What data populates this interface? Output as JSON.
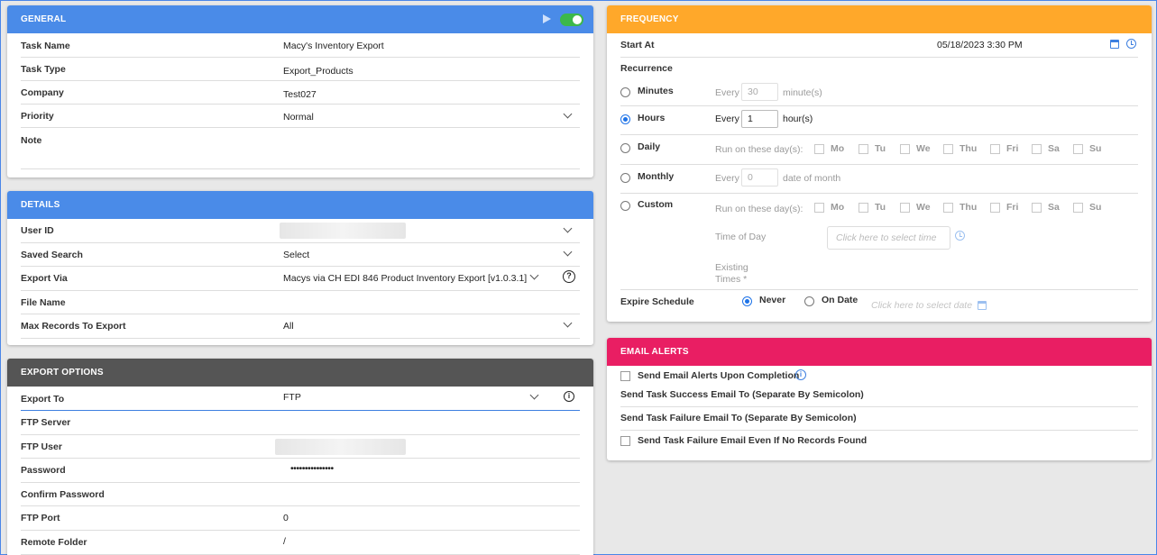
{
  "general": {
    "title": "GENERAL",
    "task_name_label": "Task Name",
    "task_name_value": "Macy's Inventory Export",
    "task_type_label": "Task Type",
    "task_type_value": "Export_Products",
    "company_label": "Company",
    "company_value": "Test027",
    "priority_label": "Priority",
    "priority_value": "Normal",
    "note_label": "Note"
  },
  "details": {
    "title": "DETAILS",
    "user_id_label": "User ID",
    "saved_search_label": "Saved Search",
    "saved_search_value": "Select",
    "export_via_label": "Export Via",
    "export_via_value": "Macys via CH EDI 846 Product Inventory Export [v1.0.3.1]",
    "file_name_label": "File Name",
    "max_records_label": "Max Records To Export",
    "max_records_value": "All"
  },
  "export_options": {
    "title": "EXPORT OPTIONS",
    "export_to_label": "Export To",
    "export_to_value": "FTP",
    "ftp_server_label": "FTP Server",
    "ftp_user_label": "FTP User",
    "password_label": "Password",
    "password_value": "•••••••••••••••",
    "confirm_password_label": "Confirm Password",
    "ftp_port_label": "FTP Port",
    "ftp_port_value": "0",
    "remote_folder_label": "Remote Folder",
    "remote_folder_value": "/"
  },
  "frequency": {
    "title": "FREQUENCY",
    "start_at_label": "Start At",
    "start_at_value": "05/18/2023 3:30 PM",
    "recurrence_label": "Recurrence",
    "minutes_label": "Minutes",
    "minutes_every": "Every",
    "minutes_value": "30",
    "minutes_unit": "minute(s)",
    "hours_label": "Hours",
    "hours_every": "Every",
    "hours_value": "1",
    "hours_unit": "hour(s)",
    "daily_label": "Daily",
    "run_on_days": "Run on these day(s):",
    "days": [
      "Mo",
      "Tu",
      "We",
      "Thu",
      "Fri",
      "Sa",
      "Su"
    ],
    "monthly_label": "Monthly",
    "monthly_every": "Every",
    "monthly_value": "0",
    "monthly_unit": "date of month",
    "custom_label": "Custom",
    "time_of_day_label": "Time of Day",
    "time_placeholder": "Click here to select time",
    "existing_times_label": "Existing",
    "existing_times_label2": "Times *",
    "expire_label": "Expire Schedule",
    "never_label": "Never",
    "on_date_label": "On Date",
    "date_placeholder": "Click here to select date"
  },
  "email_alerts": {
    "title": "EMAIL ALERTS",
    "send_upon_completion": "Send Email Alerts Upon Completion",
    "success_email_label": "Send Task Success Email To (Separate By Semicolon)",
    "failure_email_label": "Send Task Failure Email To (Separate By Semicolon)",
    "failure_no_records": "Send Task Failure Email Even If No Records Found"
  },
  "colors": {
    "blue_header": "#4a8be8",
    "dark_header": "#555555",
    "orange_header": "#ffa82a",
    "pink_header": "#e91e63",
    "toggle_on": "#3cb84a",
    "accent": "#1e73e8"
  }
}
